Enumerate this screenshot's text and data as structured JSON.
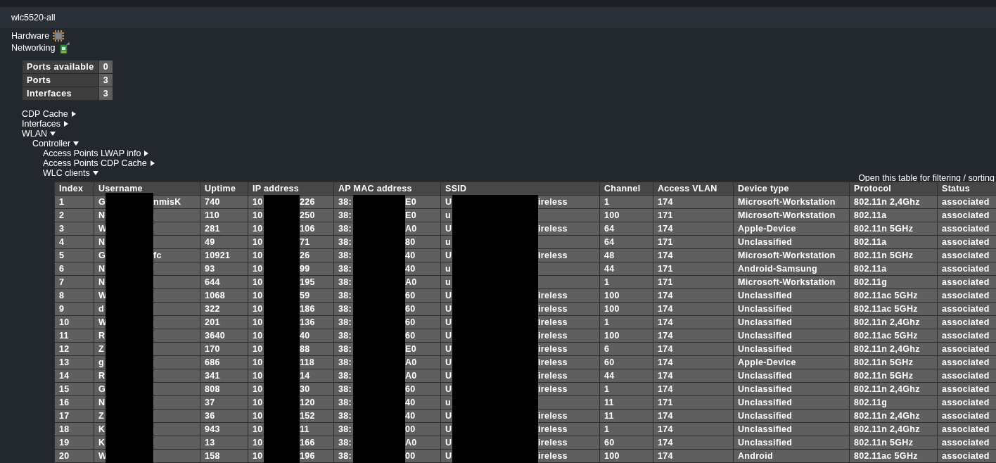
{
  "window": {
    "title": "wlc5520-all"
  },
  "sections": [
    {
      "label": "Hardware",
      "kind": "hardware"
    },
    {
      "label": "Networking",
      "kind": "networking"
    }
  ],
  "summary": [
    {
      "label": "Ports available",
      "value": "0"
    },
    {
      "label": "Ports",
      "value": "3"
    },
    {
      "label": "Interfaces",
      "value": "3"
    }
  ],
  "tree": [
    {
      "label": "CDP Cache",
      "expanded": false
    },
    {
      "label": "Interfaces",
      "expanded": false
    },
    {
      "label": "WLAN",
      "expanded": true,
      "children": [
        {
          "label": "Controller",
          "expanded": true,
          "children": [
            {
              "label": "Access Points LWAP info",
              "expanded": false
            },
            {
              "label": "Access Points CDP Cache",
              "expanded": false
            },
            {
              "label": "WLC clients",
              "expanded": true
            }
          ]
        }
      ]
    }
  ],
  "table_link": "Open this table for filtering / sorting",
  "clients": {
    "columns": [
      {
        "label": "Index",
        "redacted": false
      },
      {
        "label": "Username",
        "redacted": true
      },
      {
        "label": "Uptime",
        "redacted": false
      },
      {
        "label": "IP address",
        "redacted": true
      },
      {
        "label": "AP MAC address",
        "redacted": true
      },
      {
        "label": "SSID",
        "redacted": true
      },
      {
        "label": "Channel",
        "redacted": false
      },
      {
        "label": "Access VLAN",
        "redacted": false
      },
      {
        "label": "Device type",
        "redacted": false
      },
      {
        "label": "Protocol",
        "redacted": false
      },
      {
        "label": "Status",
        "redacted": false
      }
    ],
    "rows": [
      [
        "1",
        [
          "G",
          "nmisK"
        ],
        "740",
        [
          "10",
          "226"
        ],
        [
          "38:",
          "E0"
        ],
        [
          "U",
          "ireless"
        ],
        "1",
        "174",
        "Microsoft-Workstation",
        "802.11n 2,4Ghz",
        "associated"
      ],
      [
        "2",
        [
          "N"
        ],
        "110",
        [
          "10",
          "250"
        ],
        [
          "38:",
          "E0"
        ],
        [
          "u"
        ],
        "100",
        "171",
        "Microsoft-Workstation",
        "802.11a",
        "associated"
      ],
      [
        "3",
        [
          "W"
        ],
        "281",
        [
          "10",
          "106"
        ],
        [
          "38:",
          "A0"
        ],
        [
          "U",
          "ireless"
        ],
        "64",
        "174",
        "Apple-Device",
        "802.11n 5GHz",
        "associated"
      ],
      [
        "4",
        [
          "N"
        ],
        "49",
        [
          "10",
          "71"
        ],
        [
          "38:",
          "80"
        ],
        [
          "u"
        ],
        "64",
        "171",
        "Unclassified",
        "802.11a",
        "associated"
      ],
      [
        "5",
        [
          "G",
          "fc"
        ],
        "10921",
        [
          "10",
          "26"
        ],
        [
          "38:",
          "40"
        ],
        [
          "U",
          "ireless"
        ],
        "48",
        "174",
        "Microsoft-Workstation",
        "802.11n 5GHz",
        "associated"
      ],
      [
        "6",
        [
          "N"
        ],
        "93",
        [
          "10",
          "99"
        ],
        [
          "38:",
          "40"
        ],
        [
          "u"
        ],
        "44",
        "171",
        "Android-Samsung",
        "802.11a",
        "associated"
      ],
      [
        "7",
        [
          "N"
        ],
        "644",
        [
          "10",
          "195"
        ],
        [
          "38:",
          "A0"
        ],
        [
          "u"
        ],
        "1",
        "171",
        "Microsoft-Workstation",
        "802.11g",
        "associated"
      ],
      [
        "8",
        [
          "W"
        ],
        "1068",
        [
          "10",
          "59"
        ],
        [
          "38:",
          "60"
        ],
        [
          "U",
          "ireless"
        ],
        "100",
        "174",
        "Unclassified",
        "802.11ac 5GHz",
        "associated"
      ],
      [
        "9",
        [
          "d"
        ],
        "322",
        [
          "10",
          "186"
        ],
        [
          "38:",
          "60"
        ],
        [
          "U",
          "ireless"
        ],
        "100",
        "174",
        "Unclassified",
        "802.11ac 5GHz",
        "associated"
      ],
      [
        "10",
        [
          "W"
        ],
        "201",
        [
          "10",
          "136"
        ],
        [
          "38:",
          "60"
        ],
        [
          "U",
          "ireless"
        ],
        "1",
        "174",
        "Unclassified",
        "802.11n 2,4Ghz",
        "associated"
      ],
      [
        "11",
        [
          "R"
        ],
        "3640",
        [
          "10",
          "40"
        ],
        [
          "38:",
          "60"
        ],
        [
          "U",
          "ireless"
        ],
        "100",
        "174",
        "Unclassified",
        "802.11ac 5GHz",
        "associated"
      ],
      [
        "12",
        [
          "Z"
        ],
        "170",
        [
          "10",
          "88"
        ],
        [
          "38:",
          "E0"
        ],
        [
          "U",
          "ireless"
        ],
        "6",
        "174",
        "Unclassified",
        "802.11n 2,4Ghz",
        "associated"
      ],
      [
        "13",
        [
          "g"
        ],
        "686",
        [
          "10",
          "118"
        ],
        [
          "38:",
          "A0"
        ],
        [
          "U",
          "ireless"
        ],
        "60",
        "174",
        "Apple-Device",
        "802.11n 5GHz",
        "associated"
      ],
      [
        "14",
        [
          "R"
        ],
        "341",
        [
          "10",
          "14"
        ],
        [
          "38:",
          "A0"
        ],
        [
          "U",
          "ireless"
        ],
        "44",
        "174",
        "Unclassified",
        "802.11n 5GHz",
        "associated"
      ],
      [
        "15",
        [
          "G"
        ],
        "808",
        [
          "10",
          "30"
        ],
        [
          "38:",
          "60"
        ],
        [
          "U",
          "ireless"
        ],
        "1",
        "174",
        "Unclassified",
        "802.11n 2,4Ghz",
        "associated"
      ],
      [
        "16",
        [
          "N"
        ],
        "37",
        [
          "10",
          "120"
        ],
        [
          "38:",
          "40"
        ],
        [
          "u"
        ],
        "11",
        "171",
        "Unclassified",
        "802.11g",
        "associated"
      ],
      [
        "17",
        [
          "Z"
        ],
        "36",
        [
          "10",
          "152"
        ],
        [
          "38:",
          "40"
        ],
        [
          "U",
          "ireless"
        ],
        "11",
        "174",
        "Unclassified",
        "802.11n 2,4Ghz",
        "associated"
      ],
      [
        "18",
        [
          "K"
        ],
        "943",
        [
          "10",
          "11"
        ],
        [
          "38:",
          "00"
        ],
        [
          "U",
          "ireless"
        ],
        "1",
        "174",
        "Unclassified",
        "802.11n 2,4Ghz",
        "associated"
      ],
      [
        "19",
        [
          "K"
        ],
        "13",
        [
          "10",
          "166"
        ],
        [
          "38:",
          "A0"
        ],
        [
          "U",
          "ireless"
        ],
        "60",
        "174",
        "Unclassified",
        "802.11n 5GHz",
        "associated"
      ],
      [
        "20",
        [
          "W"
        ],
        "158",
        [
          "10",
          "196"
        ],
        [
          "38:",
          "00"
        ],
        [
          "U",
          "ireless"
        ],
        "100",
        "174",
        "Android",
        "802.11ac 5GHz",
        "associated"
      ]
    ]
  }
}
